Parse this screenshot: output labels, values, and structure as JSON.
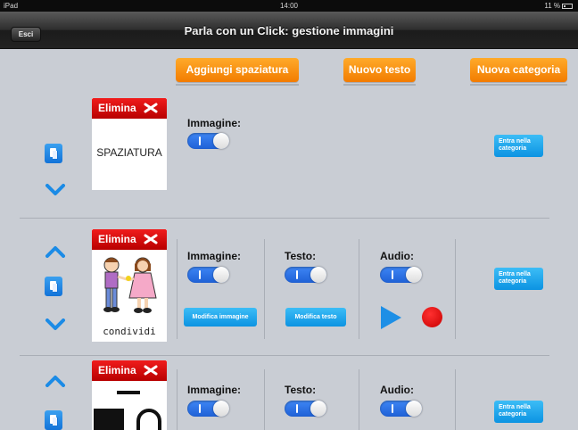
{
  "statusbar": {
    "device": "iPad",
    "time": "14:00",
    "battery": "11 %"
  },
  "navbar": {
    "title": "Parla con un Click: gestione immagini",
    "back_label": "Esci"
  },
  "toolbar": {
    "add_spacing_label": "Aggiungi spaziatura",
    "new_text_label": "Nuovo testo",
    "new_category_label": "Nuova categoria"
  },
  "common": {
    "delete_label": "Elimina",
    "image_label": "Immagine:",
    "text_label": "Testo:",
    "audio_label": "Audio:",
    "edit_image_label": "Modifica immagine",
    "edit_text_label": "Modifica testo",
    "enter_category_label": "Entra nella categoria"
  },
  "rows": [
    {
      "word": "SPAZIATURA"
    },
    {
      "word": "condividi"
    },
    {
      "word": ""
    }
  ],
  "colors": {
    "accent_orange": "#f58a0c",
    "accent_blue": "#1d8fe6",
    "delete_red": "#d40000"
  }
}
